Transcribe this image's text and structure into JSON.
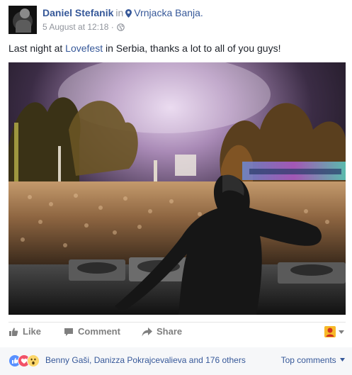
{
  "post": {
    "author": "Daniel Stefanik",
    "in_word": "in",
    "location": "Vrnjacka Banja.",
    "timestamp": "5 August at 12:18",
    "separator": "·",
    "message_prefix": "Last night at ",
    "message_link": "Lovefest",
    "message_suffix": " in Serbia, thanks a lot to all of you guys!"
  },
  "actions": {
    "like_label": "Like",
    "comment_label": "Comment",
    "share_label": "Share"
  },
  "reactions": {
    "icons": [
      "like-icon",
      "love-icon",
      "wow-icon"
    ],
    "names": "Benny Gaši, Danizza Pokrajcevalieva and 176 others",
    "top_comments_label": "Top comments"
  },
  "colors": {
    "link": "#365899",
    "muted": "#90949c",
    "like_blue": "#5890ff",
    "love_red": "#f25268",
    "wow_yellow": "#fcd76b"
  }
}
